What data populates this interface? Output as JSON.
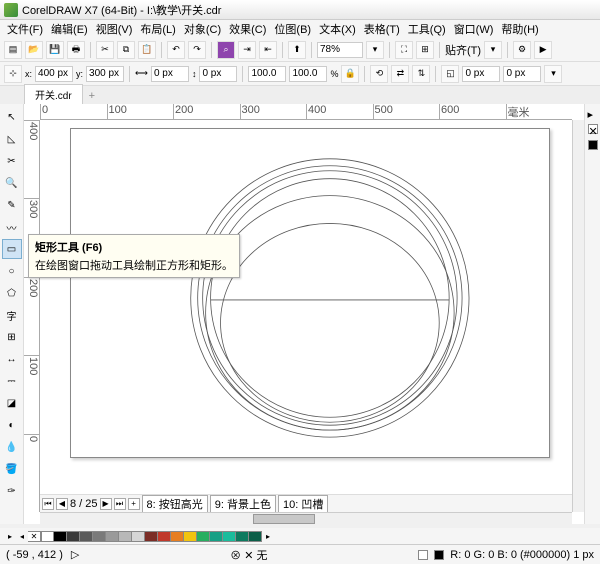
{
  "title": "CorelDRAW X7 (64-Bit) - I:\\教学\\开关.cdr",
  "menu": [
    "文件(F)",
    "编辑(E)",
    "视图(V)",
    "布局(L)",
    "对象(C)",
    "效果(C)",
    "位图(B)",
    "文本(X)",
    "表格(T)",
    "工具(Q)",
    "窗口(W)",
    "帮助(H)"
  ],
  "zoom": "78%",
  "align_label": "贴齐(T)",
  "props": {
    "x": "400 px",
    "y": "300 px",
    "sx": "0 px",
    "sy": "0 px",
    "pw": "100.0",
    "ph": "100.0",
    "ox": "0 px",
    "oy": "0 px"
  },
  "tab": {
    "name": "开关.cdr",
    "add": "+"
  },
  "ruler_h": [
    "0",
    "100",
    "200",
    "300",
    "400",
    "500",
    "600",
    "毫米"
  ],
  "ruler_v": [
    "400",
    "300",
    "200",
    "100",
    "0"
  ],
  "tooltip": {
    "title": "矩形工具 (F6)",
    "body": "在绘图窗口拖动工具绘制正方形和矩形。"
  },
  "page_nav": {
    "pages": "8 / 25",
    "tabs": [
      "8: 按钮高光",
      "9: 背景上色",
      "10: 凹槽"
    ]
  },
  "palette": [
    "#ffffff",
    "#000000",
    "#3a3a3a",
    "#5a5a5a",
    "#7a7a7a",
    "#9a9a9a",
    "#b8b8b8",
    "#d6d6d6",
    "#7b2d26",
    "#c0392b",
    "#e67e22",
    "#f1c40f",
    "#27ae60",
    "#16a085",
    "#1abc9c",
    "#0d7a5f",
    "#0b5e48"
  ],
  "status": {
    "coords": "( -59 , 412 )",
    "mid": "⊗  ✕ 无",
    "color": "R: 0 G: 0 B: 0 (#000000) 1 px"
  }
}
